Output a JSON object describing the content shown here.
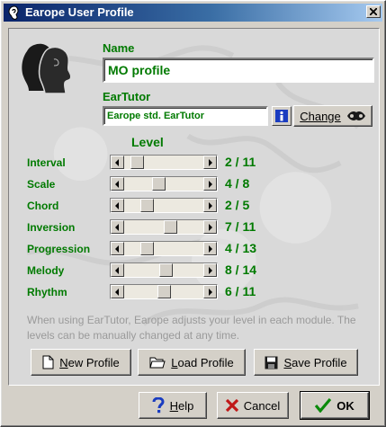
{
  "window": {
    "title": "Earope User Profile",
    "close_label": "x"
  },
  "profile": {
    "name_label": "Name",
    "name_value": "MO profile",
    "eartutor_label": "EarTutor",
    "eartutor_value": "Earope std. EarTutor",
    "change_label": "Change"
  },
  "levels": {
    "heading": "Level",
    "rows": [
      {
        "label": "Interval",
        "value": "2 / 11",
        "level": 2,
        "max": 11
      },
      {
        "label": "Scale",
        "value": "4 / 8",
        "level": 4,
        "max": 8
      },
      {
        "label": "Chord",
        "value": "2 / 5",
        "level": 2,
        "max": 5
      },
      {
        "label": "Inversion",
        "value": "7 / 11",
        "level": 7,
        "max": 11
      },
      {
        "label": "Progression",
        "value": "4 / 13",
        "level": 4,
        "max": 13
      },
      {
        "label": "Melody",
        "value": "8 / 14",
        "level": 8,
        "max": 14
      },
      {
        "label": "Rhythm",
        "value": "6 / 11",
        "level": 6,
        "max": 11
      }
    ]
  },
  "info_text": "When using EarTutor, Earope adjusts your level in each module. The levels can be manually changed at any time.",
  "profile_buttons": {
    "new_first": "N",
    "new_rest": "ew Profile",
    "load_first": "L",
    "load_rest": "oad Profile",
    "save_first": "S",
    "save_rest": "ave Profile"
  },
  "dialog_buttons": {
    "help_first": "H",
    "help_rest": "elp",
    "cancel": "Cancel",
    "ok": "OK"
  },
  "colors": {
    "accent_text": "#007a00",
    "title_gradient_start": "#0a246a",
    "title_gradient_end": "#a6caf0"
  },
  "icons": [
    "ear-icon",
    "close-icon",
    "profile-heads-icon",
    "info-icon",
    "change-icon",
    "new-document-icon",
    "open-folder-icon",
    "save-disk-icon",
    "help-icon",
    "cancel-icon",
    "ok-check-icon"
  ]
}
